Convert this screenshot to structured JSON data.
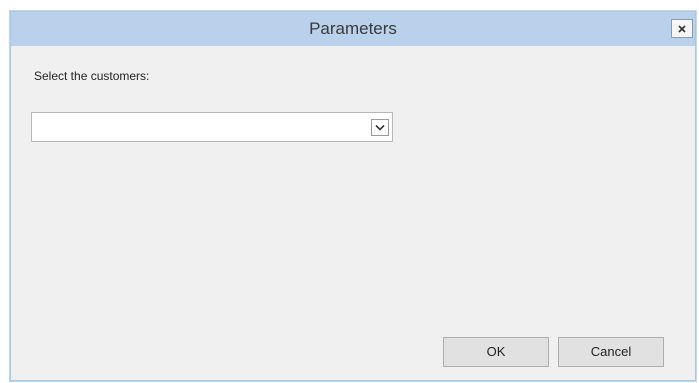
{
  "window": {
    "title": "Parameters",
    "close_icon": "close-icon"
  },
  "form": {
    "prompt_label": "Select the customers:",
    "customers_select": {
      "value": "",
      "icon": "chevron-down-icon"
    }
  },
  "buttons": {
    "ok_label": "OK",
    "cancel_label": "Cancel"
  },
  "colors": {
    "titlebar": "#b9d1ea",
    "dialog_background": "#f0f0f0",
    "button_face": "#e1e1e1"
  }
}
